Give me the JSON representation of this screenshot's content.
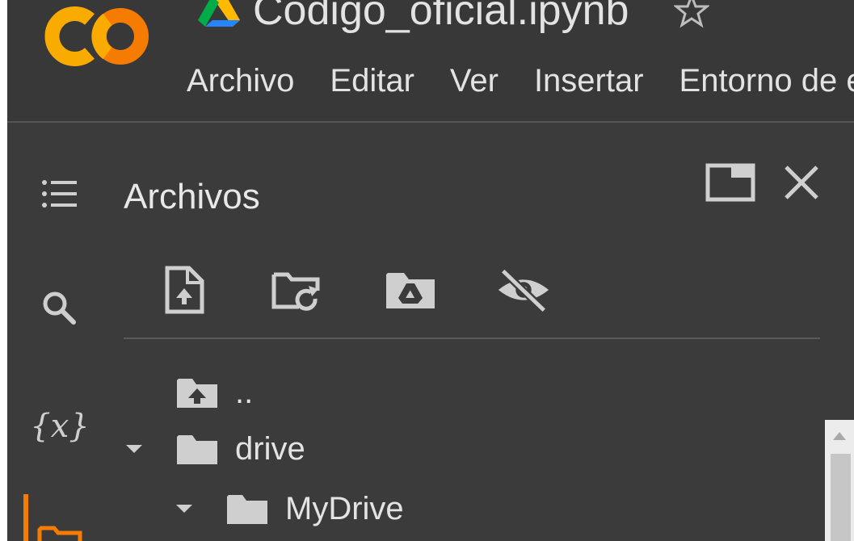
{
  "header": {
    "notebook_title": "Código_oficial.ipynb",
    "menu": [
      "Archivo",
      "Editar",
      "Ver",
      "Insertar",
      "Entorno de ejecución"
    ]
  },
  "nav_rail": {
    "items": [
      {
        "name": "table-of-contents",
        "icon": "list-icon"
      },
      {
        "name": "search",
        "icon": "search-icon"
      },
      {
        "name": "variables",
        "icon": "variables-icon",
        "glyph": "{x}"
      },
      {
        "name": "files",
        "icon": "folder-icon",
        "active": true
      }
    ]
  },
  "files_panel": {
    "title": "Archivos",
    "toolbar": [
      {
        "name": "upload-file",
        "icon": "file-upload-icon"
      },
      {
        "name": "refresh",
        "icon": "folder-refresh-icon"
      },
      {
        "name": "mount-drive",
        "icon": "drive-folder-icon"
      },
      {
        "name": "toggle-hidden",
        "icon": "eye-off-icon"
      }
    ],
    "tree": [
      {
        "label": "..",
        "icon": "folder-up-icon",
        "expanded": null,
        "depth": 0
      },
      {
        "label": "drive",
        "icon": "folder-icon",
        "expanded": true,
        "depth": 0
      },
      {
        "label": "MyDrive",
        "icon": "folder-icon",
        "expanded": true,
        "depth": 1
      }
    ]
  },
  "colors": {
    "background": "#3b3b3b",
    "text": "#e3e3e3",
    "icon": "#cfcfcf",
    "accent_orange": "#f57c00",
    "logo_yellow": "#f9ab00"
  }
}
